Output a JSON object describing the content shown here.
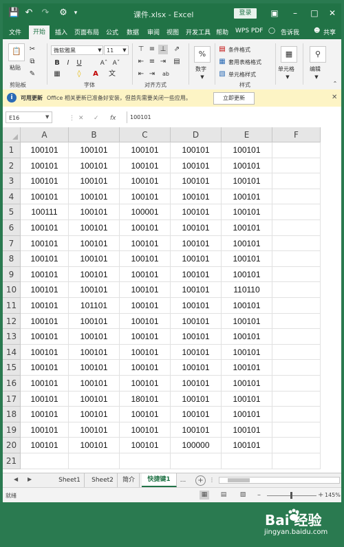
{
  "titlebar": {
    "doc_title": "课件.xlsx  -  Excel",
    "login_label": "登录"
  },
  "menu": {
    "items": [
      "文件",
      "开始",
      "插入",
      "页面布局",
      "公式",
      "数据",
      "审阅",
      "视图",
      "开发工具",
      "帮助",
      "WPS PDF",
      "告诉我",
      "共享"
    ],
    "active": "开始"
  },
  "ribbon": {
    "font_name": "微软雅黑",
    "font_size": "11",
    "paste_label": "粘贴",
    "number_label": "数字",
    "cond_format": "条件格式",
    "table_format": "套用表格格式",
    "cell_style": "单元格样式",
    "cells_label": "单元格",
    "edit_label": "编辑",
    "groups": [
      "剪贴板",
      "字体",
      "对齐方式",
      "样式"
    ]
  },
  "infobar": {
    "title": "可用更新",
    "message": "Office 相关更新已准备好安装，但首先需要关闭一些应用。",
    "button": "立即更新"
  },
  "formula": {
    "name_box": "E16",
    "value": "100101"
  },
  "sheet": {
    "columns": [
      "A",
      "B",
      "C",
      "D",
      "E",
      "F"
    ],
    "rows": [
      [
        "100101",
        "100101",
        "100101",
        "100101",
        "100101"
      ],
      [
        "100101",
        "100101",
        "100101",
        "100101",
        "100101"
      ],
      [
        "100101",
        "100101",
        "100101",
        "100101",
        "100101"
      ],
      [
        "100101",
        "100101",
        "100101",
        "100101",
        "100101"
      ],
      [
        "100111",
        "100101",
        "100001",
        "100101",
        "100101"
      ],
      [
        "100101",
        "100101",
        "100101",
        "100101",
        "100101"
      ],
      [
        "100101",
        "100101",
        "100101",
        "100101",
        "100101"
      ],
      [
        "100101",
        "100101",
        "100101",
        "100101",
        "100101"
      ],
      [
        "100101",
        "100101",
        "100101",
        "100101",
        "100101"
      ],
      [
        "100101",
        "100101",
        "100101",
        "100101",
        "110110"
      ],
      [
        "100101",
        "101101",
        "100101",
        "100101",
        "100101"
      ],
      [
        "100101",
        "100101",
        "100101",
        "100101",
        "100101"
      ],
      [
        "100101",
        "100101",
        "100101",
        "100101",
        "100101"
      ],
      [
        "100101",
        "100101",
        "100101",
        "100101",
        "100101"
      ],
      [
        "100101",
        "100101",
        "100101",
        "100101",
        "100101"
      ],
      [
        "100101",
        "100101",
        "100101",
        "100101",
        "100101"
      ],
      [
        "100101",
        "100101",
        "180101",
        "100101",
        "100101"
      ],
      [
        "100101",
        "100101",
        "100101",
        "100101",
        "100101"
      ],
      [
        "100101",
        "100101",
        "100101",
        "100101",
        "100101"
      ],
      [
        "100101",
        "100101",
        "100101",
        "100000",
        "100101"
      ],
      [
        "",
        "",
        "",
        "",
        ""
      ]
    ]
  },
  "tabs": {
    "items": [
      "Sheet1",
      "Sheet2",
      "简介",
      "快捷键1",
      "..."
    ],
    "active": "快捷键1"
  },
  "status": {
    "text": "就绪",
    "zoom": "145%"
  },
  "watermark": {
    "logo": "Bai  经验",
    "url": "jingyan.baidu.com"
  }
}
